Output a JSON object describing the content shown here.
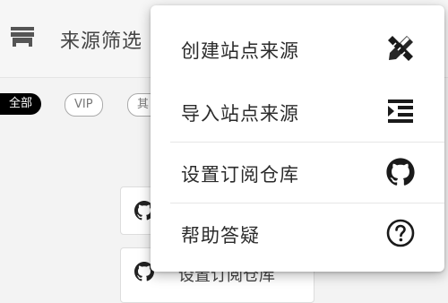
{
  "appbar": {
    "title": "来源筛选",
    "store_icon": "store-icon"
  },
  "filters": {
    "chips": [
      {
        "label": "全部",
        "selected": true
      },
      {
        "label": "VIP",
        "selected": false
      },
      {
        "label": "其",
        "selected": false
      }
    ]
  },
  "background": {
    "card_label": "设置订阅仓库",
    "card_icon": "github-icon"
  },
  "menu": {
    "items": [
      {
        "label": "创建站点来源",
        "icon": "pencil-ruler-icon"
      },
      {
        "label": "导入站点来源",
        "icon": "indent-list-icon"
      },
      {
        "label": "设置订阅仓库",
        "icon": "github-icon"
      },
      {
        "label": "帮助答疑",
        "icon": "help-circle-icon"
      }
    ]
  },
  "colors": {
    "menu_bg": "#ffffff",
    "text": "#2b2b2b",
    "chip_active_bg": "#000000"
  }
}
